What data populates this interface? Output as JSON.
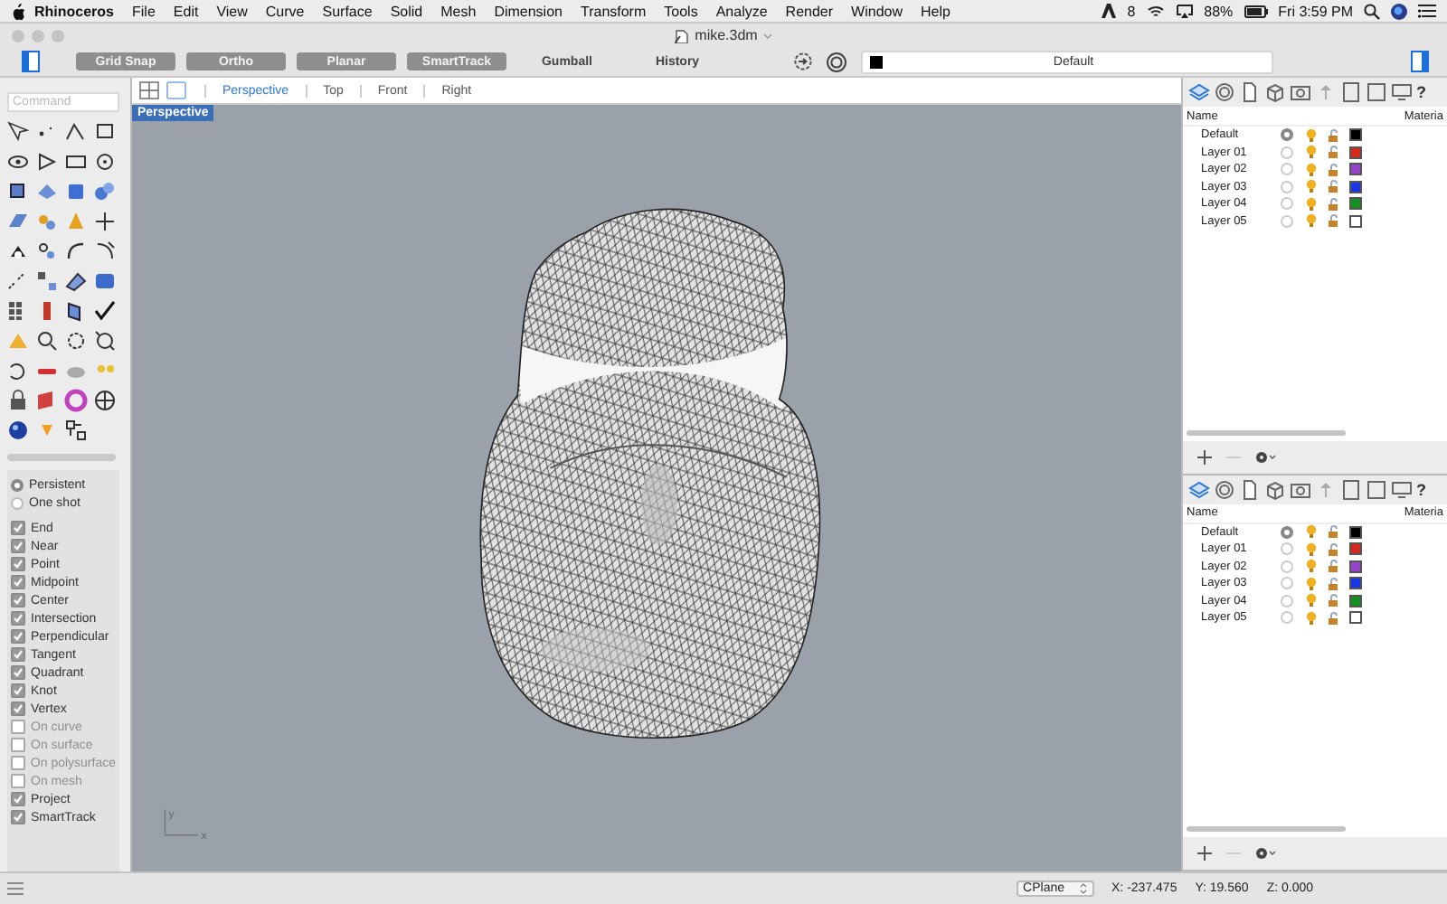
{
  "menu_bar": {
    "app": "Rhinoceros",
    "items": [
      "File",
      "Edit",
      "View",
      "Curve",
      "Surface",
      "Solid",
      "Mesh",
      "Dimension",
      "Transform",
      "Tools",
      "Analyze",
      "Render",
      "Window",
      "Help"
    ],
    "badge": "8",
    "battery": "88%",
    "clock": "Fri 3:59 PM"
  },
  "window": {
    "title": "mike.3dm"
  },
  "toolbar": {
    "toggles": [
      {
        "label": "Grid Snap",
        "on": true
      },
      {
        "label": "Ortho",
        "on": true
      },
      {
        "label": "Planar",
        "on": true
      },
      {
        "label": "SmartTrack",
        "on": true
      },
      {
        "label": "Gumball",
        "on": false
      },
      {
        "label": "History",
        "on": false
      }
    ],
    "layer": "Default"
  },
  "command": {
    "placeholder": "Command"
  },
  "viewport_tabs": [
    {
      "label": "Perspective",
      "selected": true
    },
    {
      "label": "Top",
      "selected": false
    },
    {
      "label": "Front",
      "selected": false
    },
    {
      "label": "Right",
      "selected": false
    }
  ],
  "viewport": {
    "label": "Perspective",
    "axis_labels": [
      "y",
      "x"
    ]
  },
  "osnap": {
    "modes": [
      {
        "label": "Persistent",
        "selected": true
      },
      {
        "label": "One shot",
        "selected": false
      }
    ],
    "snaps": [
      {
        "label": "End",
        "checked": true,
        "disabled": false
      },
      {
        "label": "Near",
        "checked": true,
        "disabled": false
      },
      {
        "label": "Point",
        "checked": true,
        "disabled": false
      },
      {
        "label": "Midpoint",
        "checked": true,
        "disabled": false
      },
      {
        "label": "Center",
        "checked": true,
        "disabled": false
      },
      {
        "label": "Intersection",
        "checked": true,
        "disabled": false
      },
      {
        "label": "Perpendicular",
        "checked": true,
        "disabled": false
      },
      {
        "label": "Tangent",
        "checked": true,
        "disabled": false
      },
      {
        "label": "Quadrant",
        "checked": true,
        "disabled": false
      },
      {
        "label": "Knot",
        "checked": true,
        "disabled": false
      },
      {
        "label": "Vertex",
        "checked": true,
        "disabled": false
      },
      {
        "label": "On curve",
        "checked": false,
        "disabled": true
      },
      {
        "label": "On surface",
        "checked": false,
        "disabled": true
      },
      {
        "label": "On polysurface",
        "checked": false,
        "disabled": true
      },
      {
        "label": "On mesh",
        "checked": false,
        "disabled": true
      },
      {
        "label": "Project",
        "checked": true,
        "disabled": false
      },
      {
        "label": "SmartTrack",
        "checked": true,
        "disabled": false
      }
    ]
  },
  "layer_panels": [
    {
      "help": "?",
      "columns": [
        "Name",
        "Materia"
      ],
      "layers": [
        {
          "name": "Default",
          "current": true,
          "color": "#000000"
        },
        {
          "name": "Layer 01",
          "current": false,
          "color": "#d42a1e"
        },
        {
          "name": "Layer 02",
          "current": false,
          "color": "#9444c8"
        },
        {
          "name": "Layer 03",
          "current": false,
          "color": "#1a36e6"
        },
        {
          "name": "Layer 04",
          "current": false,
          "color": "#14901e"
        },
        {
          "name": "Layer 05",
          "current": false,
          "color": "#ffffff"
        }
      ]
    },
    {
      "help": "?",
      "columns": [
        "Name",
        "Materia"
      ],
      "layers": [
        {
          "name": "Default",
          "current": true,
          "color": "#000000"
        },
        {
          "name": "Layer 01",
          "current": false,
          "color": "#d42a1e"
        },
        {
          "name": "Layer 02",
          "current": false,
          "color": "#9444c8"
        },
        {
          "name": "Layer 03",
          "current": false,
          "color": "#1a36e6"
        },
        {
          "name": "Layer 04",
          "current": false,
          "color": "#14901e"
        },
        {
          "name": "Layer 05",
          "current": false,
          "color": "#ffffff"
        }
      ]
    }
  ],
  "status_bar": {
    "cplane": "CPlane",
    "x": "X: -237.475",
    "y": "Y: 19.560",
    "z": "Z: 0.000"
  }
}
